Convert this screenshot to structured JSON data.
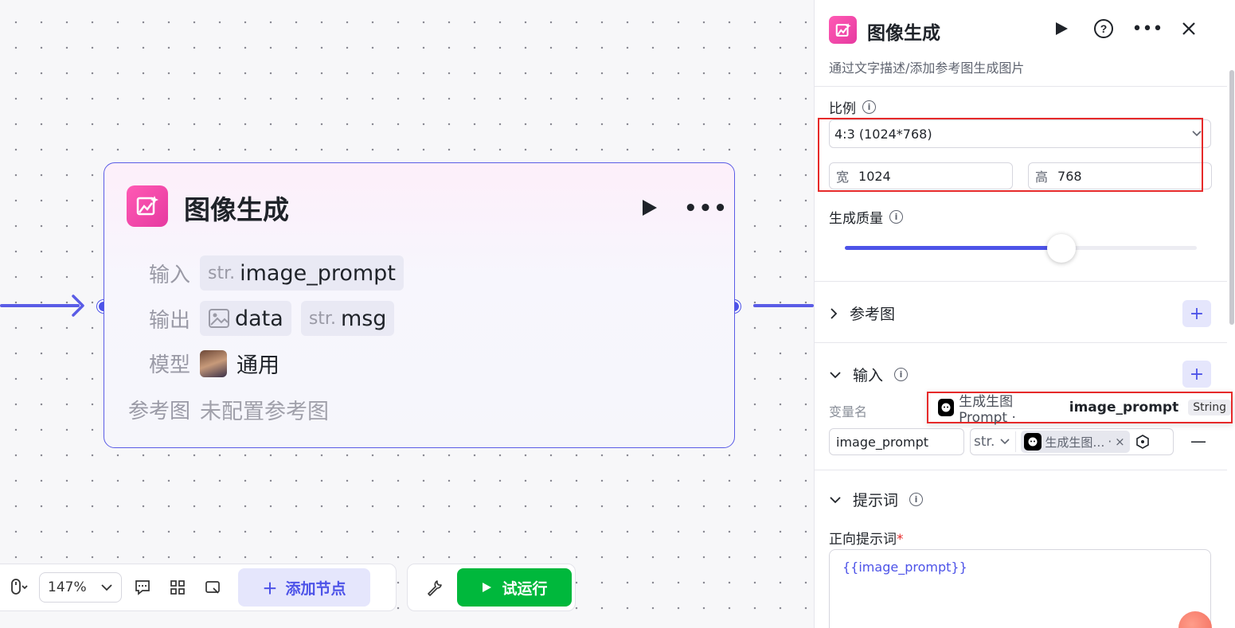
{
  "node": {
    "title": "图像生成",
    "rows": {
      "input_label": "输入",
      "input_type": "str.",
      "input_name": "image_prompt",
      "output_label": "输出",
      "output_1": "data",
      "output_2_type": "str.",
      "output_2": "msg",
      "model_label": "模型",
      "model_value": "通用",
      "ref_label": "参考图",
      "ref_value": "未配置参考图"
    }
  },
  "toolbar": {
    "zoom": "147%",
    "add_node": "添加节点",
    "test_run": "试运行"
  },
  "panel": {
    "title": "图像生成",
    "description": "通过文字描述/添加参考图生成图片",
    "ratio_label": "比例",
    "ratio_value": "4:3 (1024*768)",
    "width_label": "宽",
    "width_value": "1024",
    "height_label": "高",
    "height_value": "768",
    "quality_label": "生成质量",
    "quality_level": 0.615,
    "ref_section": "参考图",
    "input_section": "输入",
    "var_name_label": "变量名",
    "var_name_value": "image_prompt",
    "var_type": "str.",
    "ref_chip": "生成生图…",
    "prompt_section": "提示词",
    "positive_label": "正向提示词",
    "positive_required": "*",
    "positive_value": "{{image_prompt}}"
  },
  "tooltip": {
    "source": "生成生图 Prompt ·",
    "variable": "image_prompt",
    "type": "String"
  },
  "colors": {
    "accent": "#4d53e8",
    "node_icon": "#ff5ab4",
    "run_green": "#00b83c",
    "highlight_red": "#e62a2a"
  }
}
